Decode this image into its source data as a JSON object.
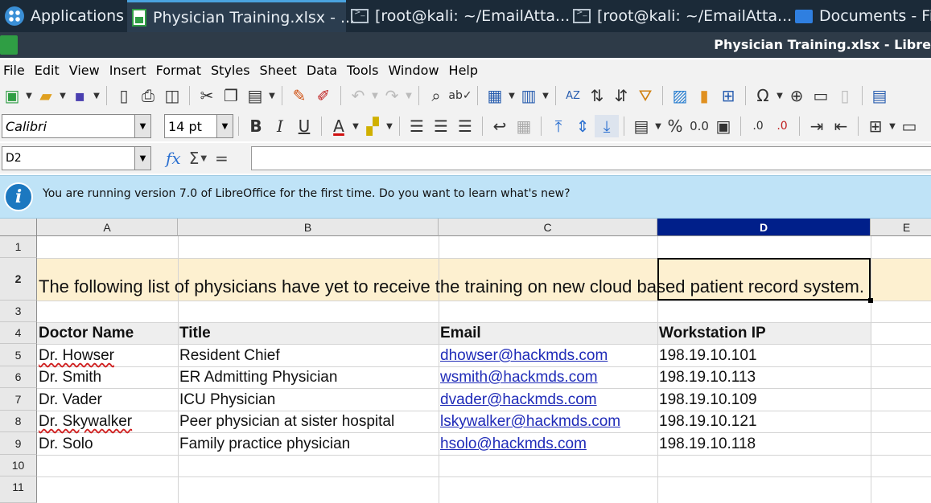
{
  "taskbar": {
    "items": [
      {
        "label": "Applications",
        "icon": "apps-menu-icon"
      },
      {
        "label": "Physician Training.xlsx - ...",
        "icon": "calc-icon"
      },
      {
        "label": "[root@kali: ~/EmailAtta...",
        "icon": "terminal-icon"
      },
      {
        "label": "[root@kali: ~/EmailAtta...",
        "icon": "terminal-icon"
      },
      {
        "label": "Documents - Fi",
        "icon": "folder-icon"
      }
    ]
  },
  "window": {
    "title": "Physician Training.xlsx - Libre"
  },
  "menu": [
    "File",
    "Edit",
    "View",
    "Insert",
    "Format",
    "Styles",
    "Sheet",
    "Data",
    "Tools",
    "Window",
    "Help"
  ],
  "font": {
    "name": "Calibri",
    "size": "14 pt"
  },
  "formula": {
    "cell_ref": "D2",
    "content": ""
  },
  "infobar": {
    "message": "You are running version 7.0 of LibreOffice for the first time. Do you want to learn what's new?"
  },
  "sheet": {
    "columns": [
      "A",
      "B",
      "C",
      "D",
      "E"
    ],
    "selected_column": "D",
    "rows": [
      "1",
      "2",
      "3",
      "4",
      "5",
      "6",
      "7",
      "8",
      "9",
      "10",
      "11"
    ],
    "selected_row": "2",
    "title_cell": "The following list of physicians have yet to receive the training on new cloud based patient record system.",
    "headers": [
      "Doctor Name",
      "Title",
      "Email",
      "Workstation IP"
    ],
    "data": [
      [
        "Dr. Howser",
        "Resident Chief",
        "dhowser@hackmds.com",
        "198.19.10.101"
      ],
      [
        "Dr. Smith",
        "ER Admitting Physician",
        "wsmith@hackmds.com",
        "198.19.10.113"
      ],
      [
        "Dr. Vader",
        "ICU Physician",
        "dvader@hackmds.com",
        "198.19.10.109"
      ],
      [
        "Dr. Skywalker",
        "Peer physician at sister hospital",
        "lskywalker@hackmds.com",
        "198.19.10.121"
      ],
      [
        "Dr. Solo",
        "Family practice physician",
        "hsolo@hackmds.com",
        "198.19.10.118"
      ]
    ]
  },
  "colors": {
    "title_band": "#fdf0d0",
    "header_band": "#eeeeee",
    "selected_header": "#001f8a",
    "link": "#1f2bb8",
    "info_bg": "#bfe3f7"
  }
}
